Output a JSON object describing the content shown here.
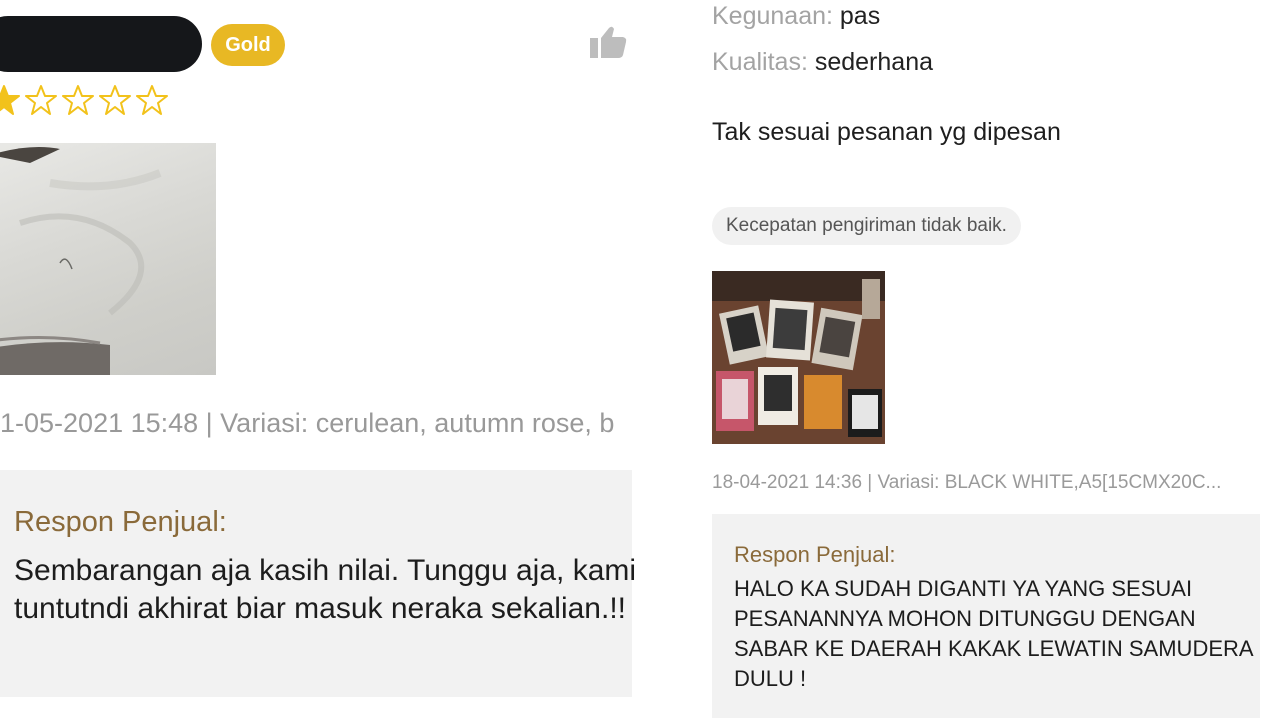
{
  "left_review": {
    "badge": "Gold",
    "rating": 1,
    "max_rating": 5,
    "meta": "1-05-2021 15:48 | Variasi: cerulean, autumn rose, b",
    "response": {
      "title": "Respon Penjual:",
      "body": "Sembarangan aja kasih nilai. Tunggu aja, kami tuntutndi akhirat biar masuk neraka sekalian.!!"
    }
  },
  "right_review": {
    "attributes": [
      {
        "label": "Kegunaan:",
        "value": "pas"
      },
      {
        "label": "Kualitas:",
        "value": "sederhana"
      }
    ],
    "text": "Tak sesuai pesanan yg dipesan",
    "chip": "Kecepatan pengiriman tidak baik.",
    "meta": "18-04-2021 14:36 | Variasi: BLACK WHITE,A5[15CMX20C...",
    "response": {
      "title": "Respon Penjual:",
      "body": "HALO KA SUDAH DIGANTI YA YANG SESUAI PESANANNYA MOHON DITUNGGU DENGAN SABAR KE DAERAH KAKAK LEWATIN SAMUDERA DULU !"
    }
  },
  "colors": {
    "gold_badge": "#e8b824",
    "star": "#f2c21b",
    "seller_title": "#8a6a3a",
    "response_bg": "#f2f2f2"
  },
  "icons": {
    "like": "thumbs-up-icon",
    "star": "star-icon"
  }
}
